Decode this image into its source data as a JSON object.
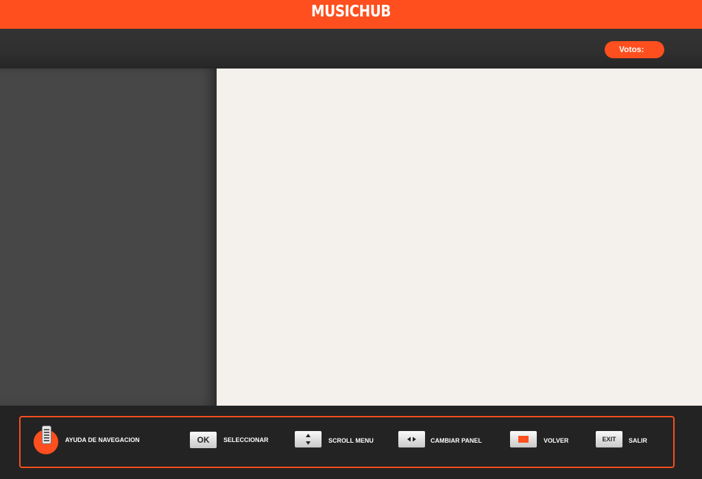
{
  "header": {
    "logo_text": "MUSICHUB"
  },
  "votes": {
    "label": "Votos:"
  },
  "help": {
    "title": "AYUDA DE NAVEGACION",
    "items": [
      {
        "key": "OK",
        "label": "SELECCIONAR"
      },
      {
        "key_icon": "up-down-arrows-icon",
        "label": "SCROLL MENU"
      },
      {
        "key_icon": "left-right-arrows-icon",
        "label": "CAMBIAR PANEL"
      },
      {
        "key_icon": "red-button-icon",
        "label": "VOLVER"
      },
      {
        "key": "EXIT",
        "label": "SALIR"
      }
    ]
  },
  "colors": {
    "accent": "#ff4f1e",
    "panel_dark": "#474747",
    "panel_light": "#f4f0ec"
  }
}
